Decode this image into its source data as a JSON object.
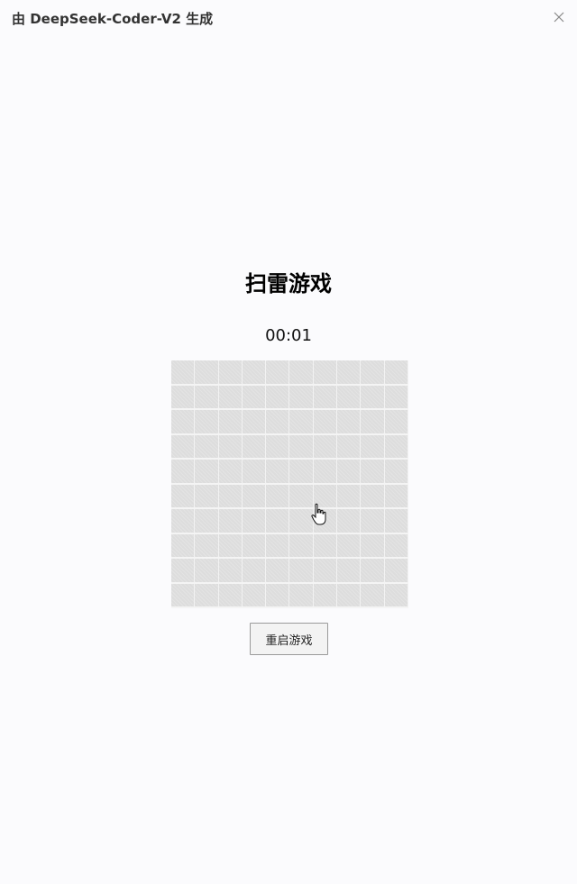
{
  "window": {
    "title": "由 DeepSeek-Coder-V2 生成",
    "close_icon": "close-icon"
  },
  "game": {
    "title": "扫雷游戏",
    "timer": "00:01",
    "board": {
      "rows": 10,
      "cols": 10,
      "state": "all-covered"
    },
    "restart_label": "重启游戏"
  },
  "colors": {
    "background": "#fbfbfd",
    "cell_covered": "#dddddd",
    "cell_border": "#f2f2f2"
  },
  "pointer": {
    "icon": "hand-pointer-icon"
  }
}
